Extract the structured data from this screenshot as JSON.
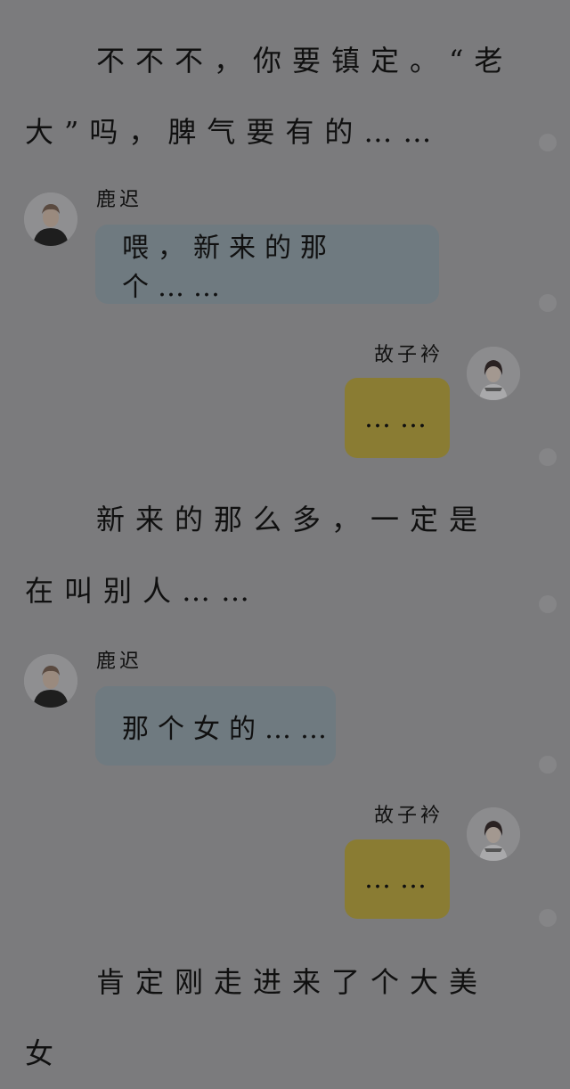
{
  "paragraphs": [
    "不不不，你要镇定。“老大”吗，脾气要有的……",
    "新来的那么多，一定是在叫别人……",
    "肯定刚走进来了个大美女"
  ],
  "messages": [
    {
      "sender": "鹿迟",
      "side": "left",
      "text": "喂，新来的那个……"
    },
    {
      "sender": "故子衿",
      "side": "right",
      "text": "……"
    },
    {
      "sender": "鹿迟",
      "side": "left",
      "text": "那个女的……"
    },
    {
      "sender": "故子衿",
      "side": "right",
      "text": "……"
    }
  ],
  "colors": {
    "background": "#7b7b7d",
    "left_bubble": "#6f7a80",
    "right_bubble": "#8a7c33",
    "text": "#101010"
  },
  "icons": [
    "avatar-luchi-icon",
    "avatar-guzijin-icon",
    "scroll-dot-icon"
  ]
}
